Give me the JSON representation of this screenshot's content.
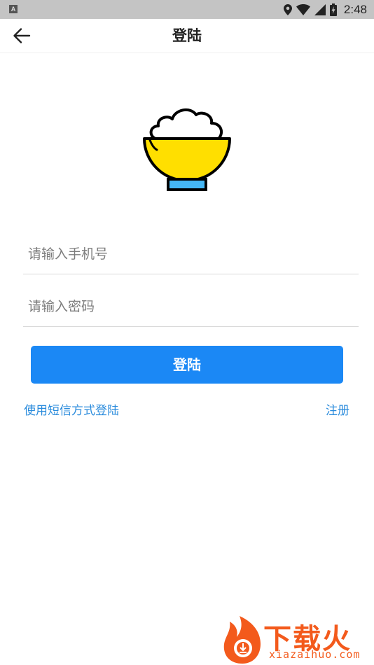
{
  "status_bar": {
    "left_icon": "A",
    "time": "2:48",
    "icons": [
      "location-icon",
      "wifi-icon",
      "signal-icon",
      "battery-charging-icon"
    ]
  },
  "app_bar": {
    "back_icon": "arrow-left-icon",
    "title": "登陆"
  },
  "logo": {
    "icon": "rice-bowl-icon",
    "colors": {
      "bowl": "#FFDF00",
      "base": "#45B7F5",
      "outline": "#000000"
    }
  },
  "form": {
    "phone_placeholder": "请输入手机号",
    "password_placeholder": "请输入密码",
    "login_button": "登陆"
  },
  "links": {
    "sms_login": "使用短信方式登陆",
    "register": "注册"
  },
  "watermark": {
    "brand": "下载火",
    "domain": "xiazaihuo.com"
  },
  "colors": {
    "primary": "#1B88F5",
    "link": "#2A8BDC",
    "watermark": "#F35A1C"
  }
}
